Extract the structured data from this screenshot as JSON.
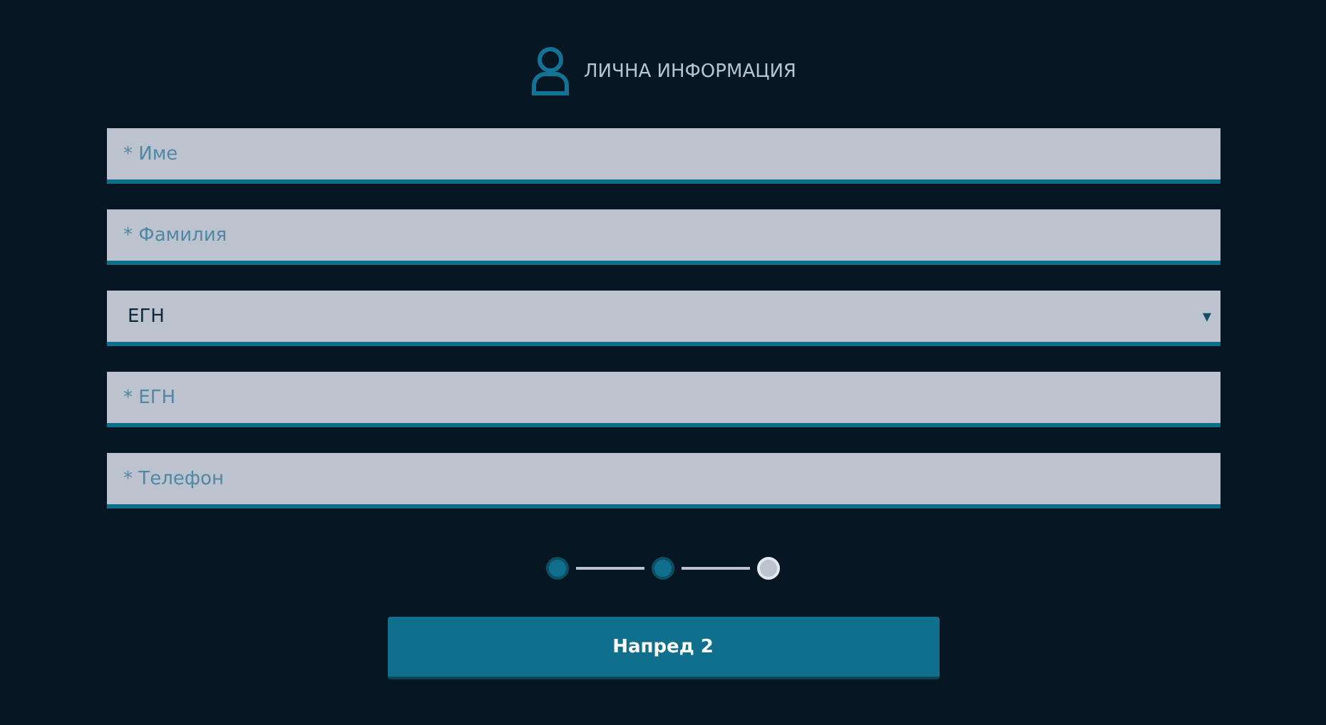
{
  "header": {
    "title": "ЛИЧНА ИНФОРМАЦИЯ"
  },
  "fields": [
    {
      "kind": "text",
      "placeholder": "* Име"
    },
    {
      "kind": "text",
      "placeholder": "* Фамилия"
    },
    {
      "kind": "select",
      "value": "ЕГН",
      "caret": "▾"
    },
    {
      "kind": "text",
      "placeholder": "* ЕГН"
    },
    {
      "kind": "text",
      "placeholder": "* Телефон"
    }
  ],
  "steps": [
    {
      "done": true
    },
    {
      "done": true
    },
    {
      "done": false
    }
  ],
  "button": {
    "label": "Напред 2"
  }
}
